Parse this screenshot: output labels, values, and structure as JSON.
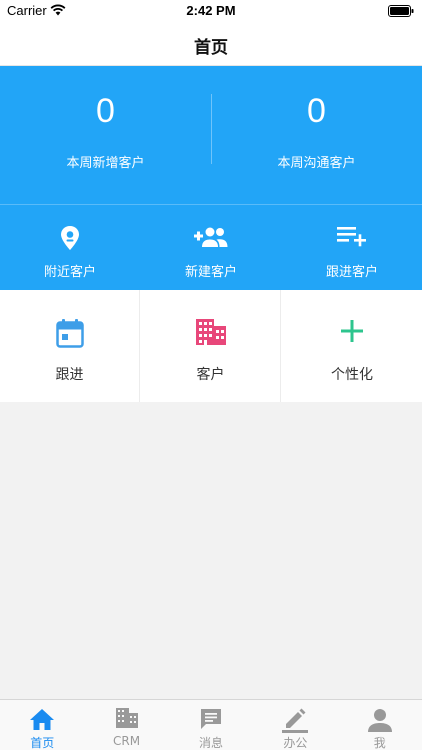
{
  "status_bar": {
    "carrier": "Carrier",
    "time": "2:42 PM"
  },
  "header": {
    "title": "首页"
  },
  "stats": [
    {
      "value": "0",
      "label": "本周新增客户"
    },
    {
      "value": "0",
      "label": "本周沟通客户"
    }
  ],
  "quick_actions": [
    {
      "label": "附近客户",
      "icon": "location-pin-icon"
    },
    {
      "label": "新建客户",
      "icon": "add-user-icon"
    },
    {
      "label": "跟进客户",
      "icon": "list-add-icon"
    }
  ],
  "shortcuts": [
    {
      "label": "跟进",
      "icon": "calendar-icon",
      "color": "#3e9ee8"
    },
    {
      "label": "客户",
      "icon": "building-icon",
      "color": "#e8477a"
    },
    {
      "label": "个性化",
      "icon": "plus-icon",
      "color": "#2dc58e"
    }
  ],
  "tabs": [
    {
      "label": "首页",
      "icon": "home-icon",
      "active": true
    },
    {
      "label": "CRM",
      "icon": "crm-building-icon",
      "active": false
    },
    {
      "label": "消息",
      "icon": "message-icon",
      "active": false
    },
    {
      "label": "办公",
      "icon": "pencil-icon",
      "active": false
    },
    {
      "label": "我",
      "icon": "person-icon",
      "active": false
    }
  ],
  "colors": {
    "primary": "#22a5f7",
    "tab_active": "#1a8bf0",
    "tab_inactive": "#999999"
  }
}
